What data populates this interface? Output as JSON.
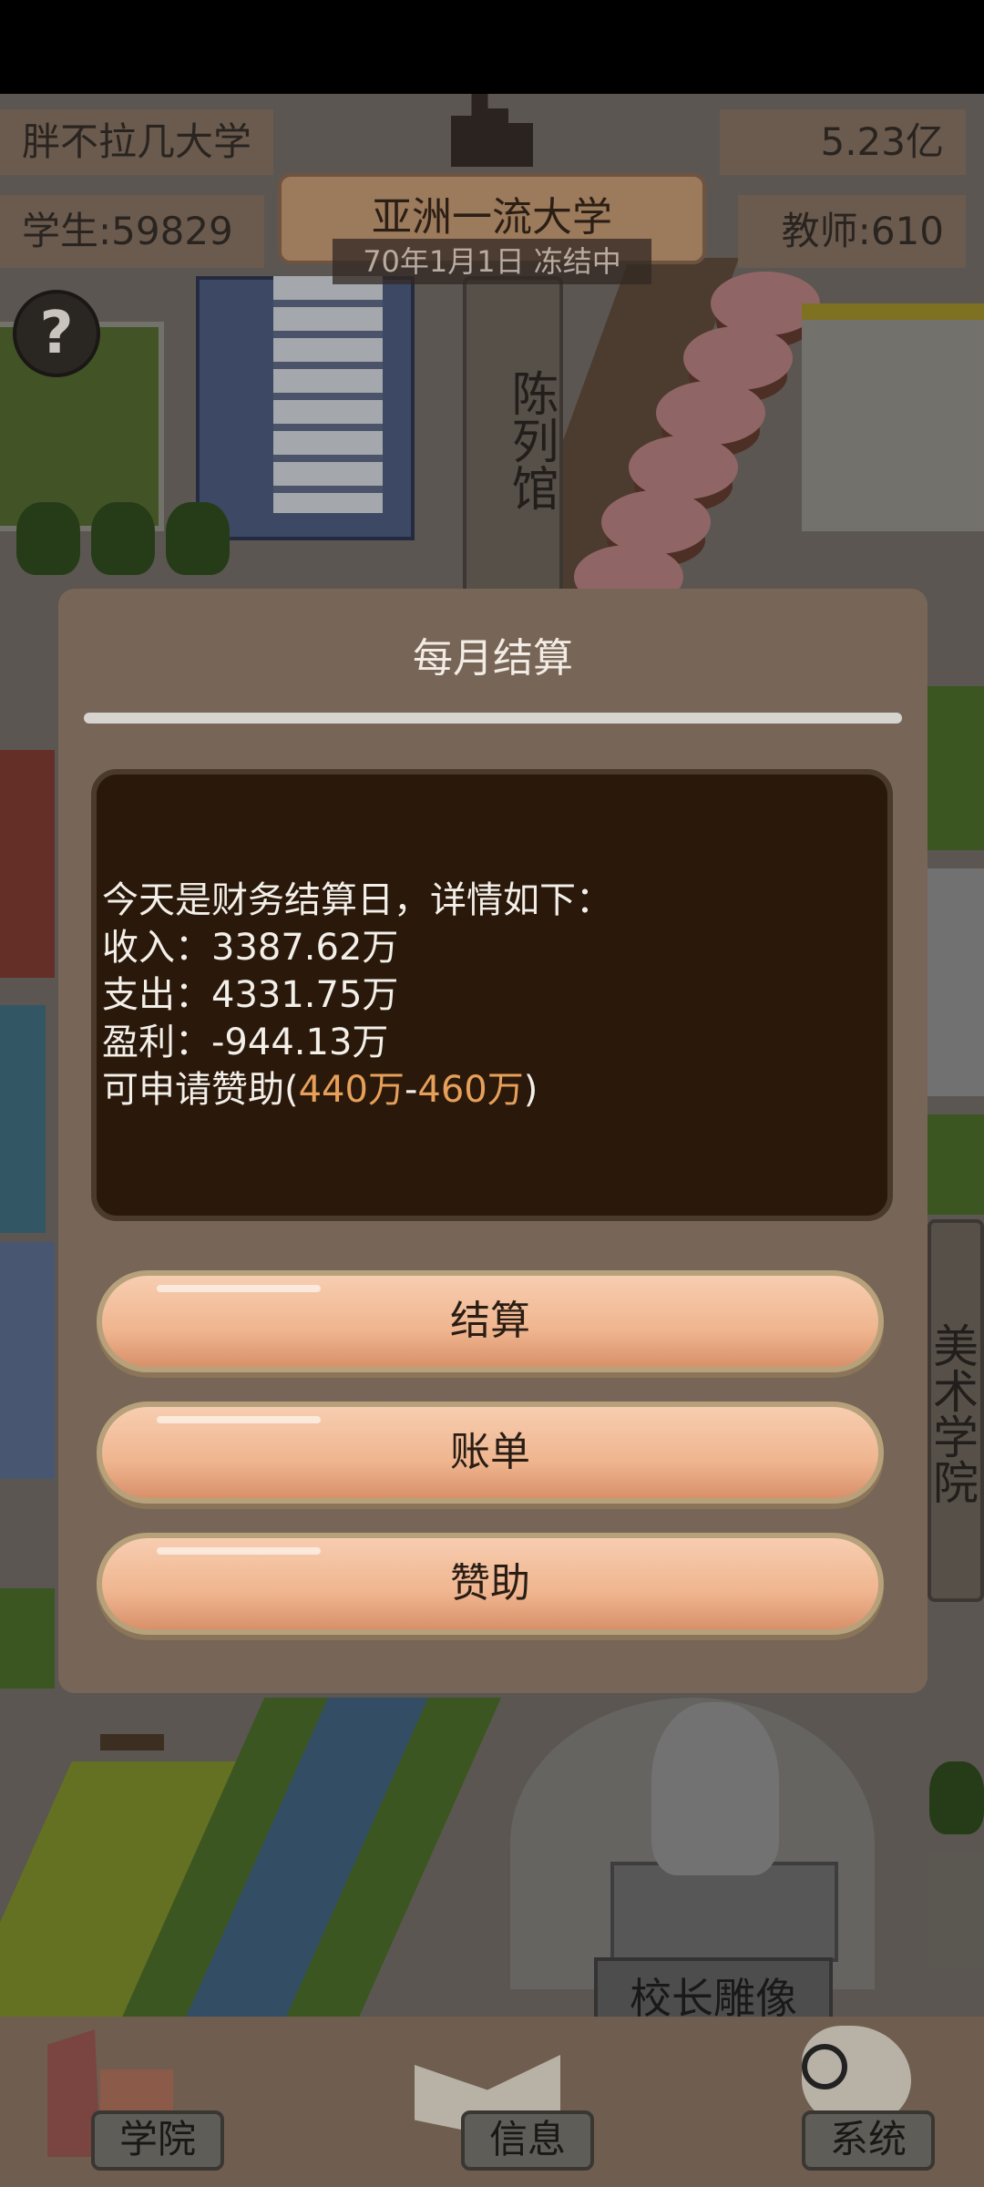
{
  "hud": {
    "school_name": "胖不拉几大学",
    "money": "5.23亿",
    "students": "学生:59829",
    "teachers": "教师:610",
    "rank_title": "亚洲一流大学",
    "date_status": "70年1月1日 冻结中",
    "help_symbol": "?"
  },
  "map": {
    "exhibition_hall": "陈列馆",
    "art_college": "美术学院",
    "statue_label": "校长雕像"
  },
  "modal": {
    "title": "每月结算",
    "intro": "今天是财务结算日，详情如下：",
    "income": "收入：3387.62万",
    "expense": "支出：4331.75万",
    "profit": "盈利：-944.13万",
    "sponsor_prefix": "可申请赞助(",
    "sponsor_min": "440万",
    "sponsor_dash": "-",
    "sponsor_max": "460万",
    "sponsor_suffix": ")",
    "buttons": {
      "settle": "结算",
      "bill": "账单",
      "sponsor": "赞助"
    }
  },
  "bottom_nav": {
    "college": "学院",
    "info": "信息",
    "system": "系统"
  },
  "colors": {
    "modal_bg": "#776657",
    "info_bg": "#2a190b",
    "highlight": "#e7a05a",
    "button": "#efb58f"
  },
  "icons": [
    "help-icon",
    "college-icon",
    "book-icon",
    "scroll-magnifier-icon"
  ]
}
